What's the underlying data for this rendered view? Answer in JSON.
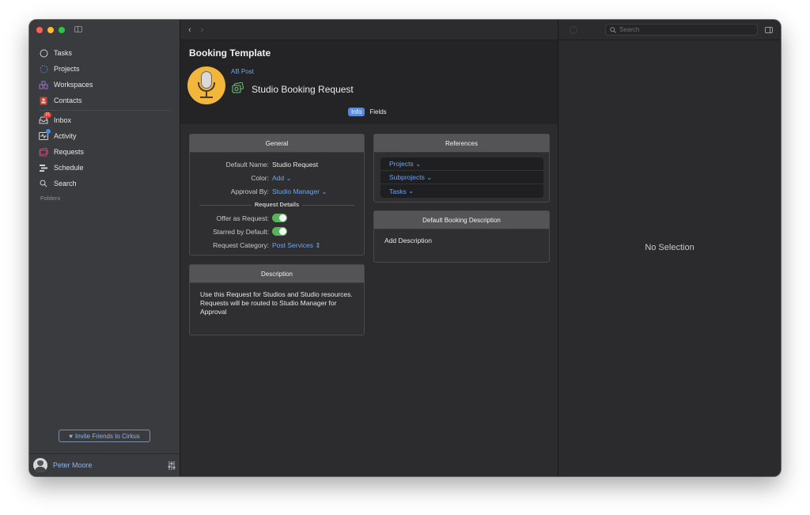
{
  "sidebar": {
    "items": [
      {
        "label": "Tasks",
        "icon": "circle-icon"
      },
      {
        "label": "Projects",
        "icon": "dashed-circle-icon"
      },
      {
        "label": "Workspaces",
        "icon": "workspaces-icon"
      },
      {
        "label": "Contacts",
        "icon": "contacts-icon"
      },
      {
        "label": "Inbox",
        "icon": "inbox-icon",
        "badge": "21"
      },
      {
        "label": "Activity",
        "icon": "activity-icon"
      },
      {
        "label": "Requests",
        "icon": "requests-icon"
      },
      {
        "label": "Schedule",
        "icon": "schedule-icon"
      },
      {
        "label": "Search",
        "icon": "search-icon"
      }
    ],
    "folders_label": "Folders",
    "invite_label": "Invite Friends to Cirkus",
    "user_name": "Peter Moore"
  },
  "toolbar": {
    "back": "‹",
    "forward": "›"
  },
  "header": {
    "title": "Booking Template",
    "parent": "AB Post",
    "request_title": "Studio Booking Request",
    "tabs": [
      "Info",
      "Fields"
    ],
    "active_tab": "Info"
  },
  "general": {
    "heading": "General",
    "default_name_label": "Default Name:",
    "default_name_value": "Studio Request",
    "color_label": "Color:",
    "color_value": "Add",
    "approval_label": "Approval By:",
    "approval_value": "Studio Manager",
    "section_label": "Request Details",
    "offer_label": "Offer as Request:",
    "offer_value": true,
    "starred_label": "Starred by Default:",
    "starred_value": true,
    "category_label": "Request Category:",
    "category_value": "Post Services"
  },
  "description": {
    "heading": "Description",
    "text": "Use this Request for Studios and Studio resources. Requests will be routed to Studio Manager for Approval"
  },
  "references": {
    "heading": "References",
    "items": [
      "Projects",
      "Subprojects",
      "Tasks"
    ]
  },
  "booking_description": {
    "heading": "Default Booking Description",
    "text": "Add Description"
  },
  "right_pane": {
    "search_placeholder": "Search",
    "empty_text": "No Selection"
  },
  "colors": {
    "accent": "#6ea4ec",
    "toggle_on": "#5ab35a",
    "template_icon_bg": "#f2b73a"
  }
}
